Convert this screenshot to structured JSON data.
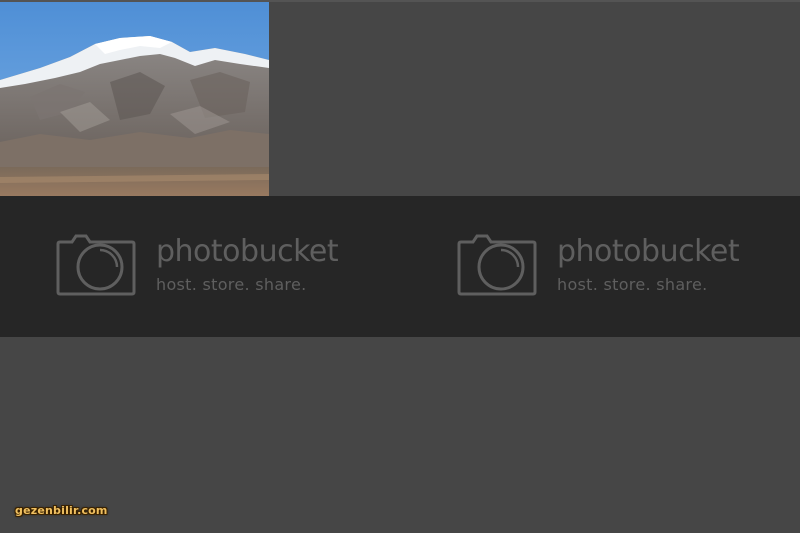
{
  "photo": {
    "subject": "snow-capped mountain"
  },
  "placeholders": [
    {
      "brand": "photobucket",
      "tagline": "host. store. share.",
      "icon": "camera-icon"
    },
    {
      "brand": "photobucket",
      "tagline": "host. store. share.",
      "icon": "camera-icon"
    }
  ],
  "watermark": {
    "text": "gezenbilir.com"
  },
  "colors": {
    "background": "#464646",
    "band": "#262626",
    "logo": "#5f5f5f",
    "watermark": "#f0c060"
  }
}
